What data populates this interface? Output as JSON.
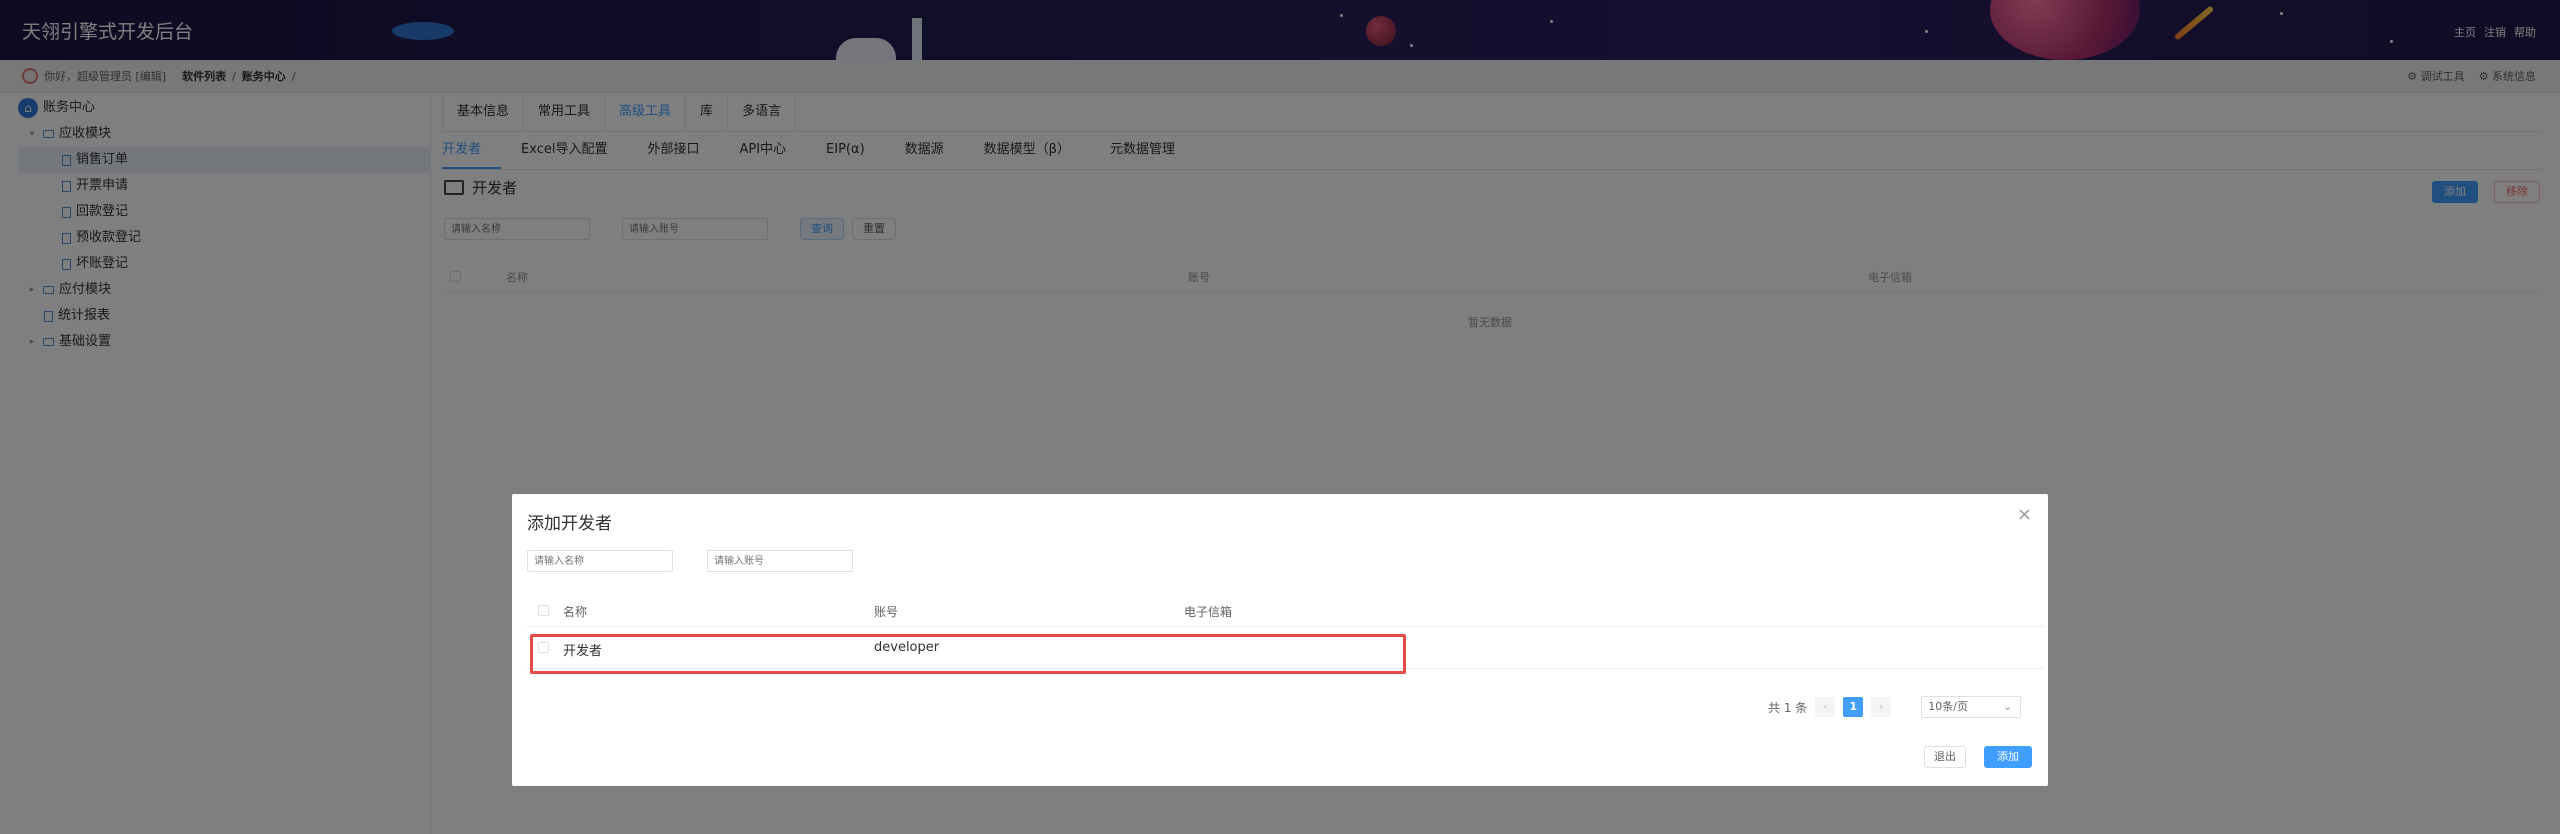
{
  "header": {
    "title": "天翎引擎式开发后台",
    "links": [
      "主页",
      "注销",
      "帮助"
    ]
  },
  "topbar": {
    "greeting": "你好，超级管理员 [编辑]",
    "crumbs": [
      "软件列表",
      "账务中心"
    ],
    "separator": "/",
    "tools": [
      "调试工具",
      "系统信息"
    ]
  },
  "sidebar": {
    "root": "账务中心",
    "items": [
      {
        "label": "应收模块",
        "expanded": true
      },
      {
        "label": "销售订单",
        "selected": true
      },
      {
        "label": "开票申请"
      },
      {
        "label": "回款登记"
      },
      {
        "label": "预收款登记"
      },
      {
        "label": "坏账登记"
      },
      {
        "label": "应付模块",
        "expanded": false
      },
      {
        "label": "统计报表"
      },
      {
        "label": "基础设置",
        "expanded": false
      }
    ]
  },
  "main": {
    "tabs1": [
      "基本信息",
      "常用工具",
      "高级工具",
      "库",
      "多语言"
    ],
    "tabs1_active": 2,
    "tabs2": [
      "开发者",
      "Excel导入配置",
      "外部接口",
      "API中心",
      "EIP(α)",
      "数据源",
      "数据模型（β）",
      "元数据管理"
    ],
    "tabs2_active": 0,
    "page_title": "开发者",
    "add_button": "添加",
    "remove_button": "移除",
    "name_placeholder": "请输入名称",
    "account_placeholder": "请输入账号",
    "query_button": "查询",
    "reset_button": "重置",
    "columns": [
      "名称",
      "账号",
      "电子信箱"
    ],
    "empty_text": "暂无数据"
  },
  "dialog": {
    "title": "添加开发者",
    "close_glyph": "×",
    "name_placeholder": "请输入名称",
    "account_placeholder": "请输入账号",
    "columns": [
      "名称",
      "账号",
      "电子信箱"
    ],
    "rows": [
      {
        "name": "开发者",
        "account": "developer",
        "email": ""
      }
    ],
    "total_text": "共 1 条",
    "current_page": "1",
    "prev_glyph": "‹",
    "next_glyph": "›",
    "page_size": "10条/页",
    "exit_button": "退出",
    "add_button": "添加"
  },
  "colors": {
    "accent": "#409eff",
    "header_bg": "#1f1a4d",
    "highlight": "#e64b4b",
    "danger": "#f56c6c"
  }
}
